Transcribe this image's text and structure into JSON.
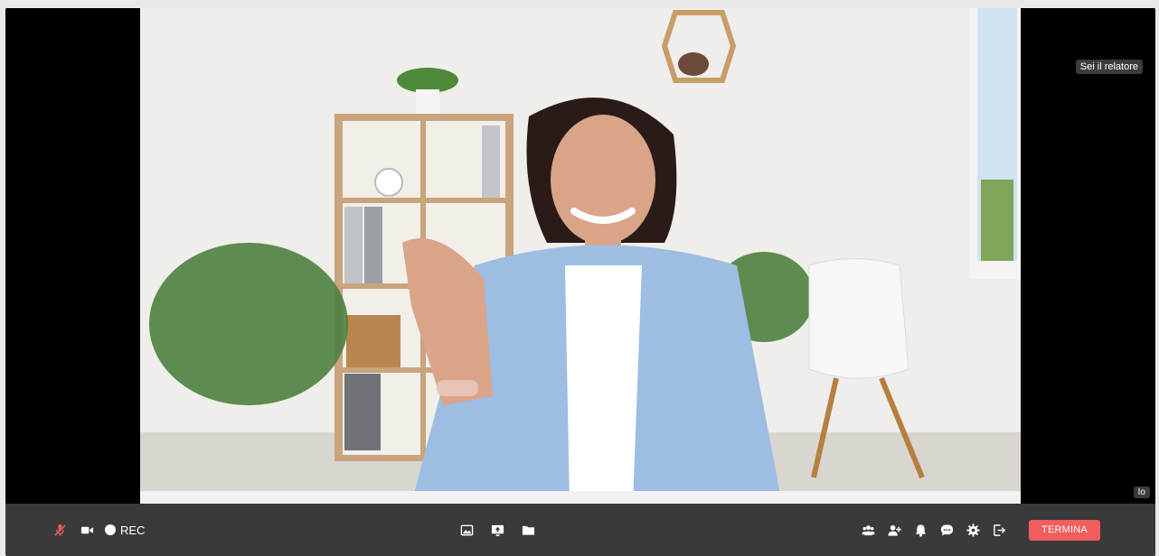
{
  "stage": {
    "presenter_badge": "Sei il relatore",
    "self_badge": "Io"
  },
  "controls": {
    "left": [
      {
        "name": "mic-muted-icon",
        "color": "#f25d5d"
      },
      {
        "name": "camera-icon",
        "color": "#ffffff"
      }
    ],
    "rec_label": "REC",
    "center": [
      {
        "name": "image-icon"
      },
      {
        "name": "screen-share-icon"
      },
      {
        "name": "folder-icon"
      }
    ],
    "right": [
      {
        "name": "participants-icon"
      },
      {
        "name": "add-user-icon"
      },
      {
        "name": "notification-bell-icon"
      },
      {
        "name": "chat-icon"
      },
      {
        "name": "settings-icon"
      },
      {
        "name": "exit-icon"
      }
    ],
    "end_label": "TERMINA"
  },
  "colors": {
    "accent": "#f25d5d",
    "toolbar": "#3a3a3a",
    "background": "#000000"
  }
}
